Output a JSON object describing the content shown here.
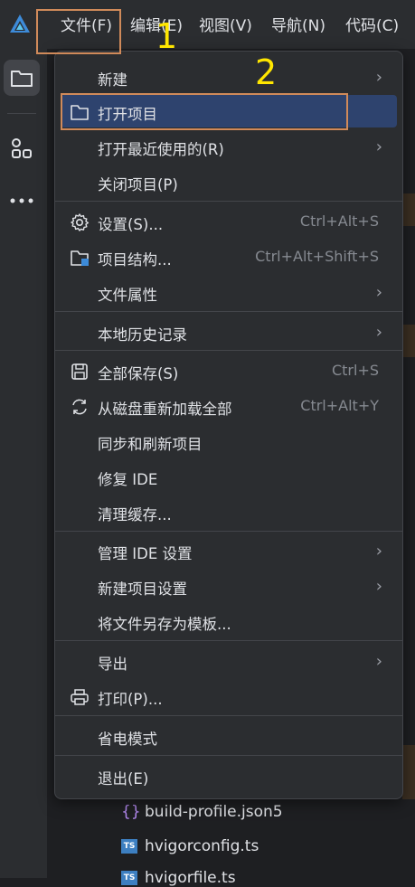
{
  "menubar": {
    "items": [
      {
        "label": "文件(F)"
      },
      {
        "label": "编辑(E)"
      },
      {
        "label": "视图(V)"
      },
      {
        "label": "导航(N)"
      },
      {
        "label": "代码(C)"
      }
    ]
  },
  "annotations": {
    "one": "1",
    "two": "2"
  },
  "file_menu": {
    "new": {
      "label": "新建"
    },
    "open_project": {
      "label": "打开项目"
    },
    "open_recent": {
      "label": "打开最近使用的(R)"
    },
    "close_project": {
      "label": "关闭项目(P)"
    },
    "settings": {
      "label": "设置(S)...",
      "shortcut": "Ctrl+Alt+S"
    },
    "project_structure": {
      "label": "项目结构...",
      "shortcut": "Ctrl+Alt+Shift+S"
    },
    "file_properties": {
      "label": "文件属性"
    },
    "local_history": {
      "label": "本地历史记录"
    },
    "save_all": {
      "label": "全部保存(S)",
      "shortcut": "Ctrl+S"
    },
    "reload_all": {
      "label": "从磁盘重新加载全部",
      "shortcut": "Ctrl+Alt+Y"
    },
    "sync_refresh": {
      "label": "同步和刷新项目"
    },
    "repair_ide": {
      "label": "修复 IDE"
    },
    "clear_cache": {
      "label": "清理缓存..."
    },
    "manage_ide_settings": {
      "label": "管理 IDE 设置"
    },
    "new_project_settings": {
      "label": "新建项目设置"
    },
    "save_as_template": {
      "label": "将文件另存为模板..."
    },
    "export": {
      "label": "导出"
    },
    "print": {
      "label": "打印(P)..."
    },
    "power_save": {
      "label": "省电模式"
    },
    "exit": {
      "label": "退出(E)"
    }
  },
  "tree": {
    "items": [
      {
        "label": "build-profile.json5",
        "icon": "braces-icon"
      },
      {
        "label": "hvigorconfig.ts",
        "icon": "ts-file-icon"
      },
      {
        "label": "hvigorfile.ts",
        "icon": "ts-file-icon"
      }
    ]
  },
  "colors": {
    "highlight": "#2e436e",
    "annotation_box": "#d08a5a",
    "annotation_number": "#ffe600"
  }
}
